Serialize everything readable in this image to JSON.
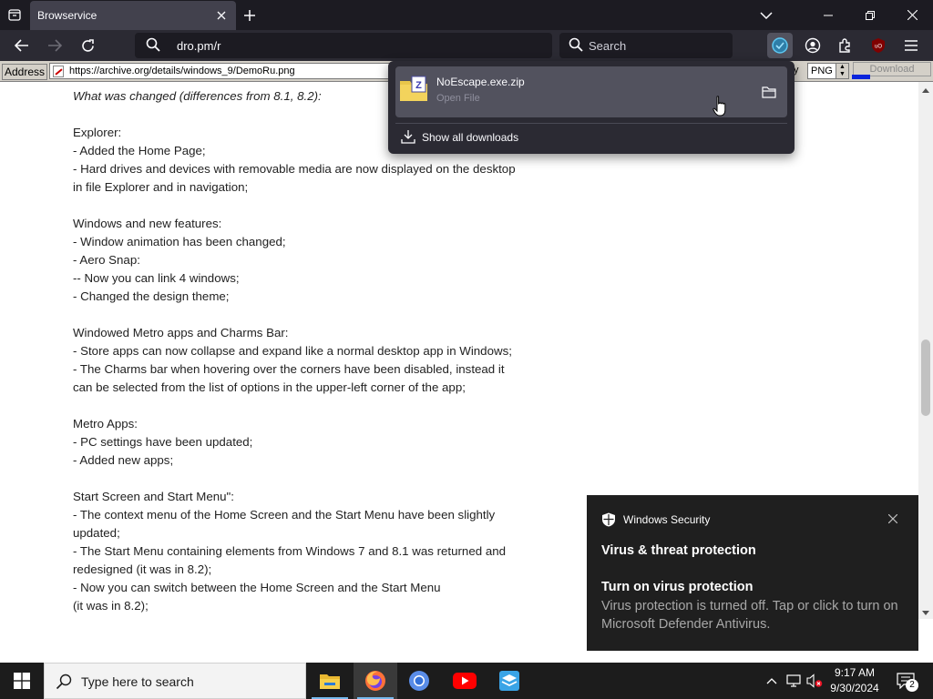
{
  "browser": {
    "tab_title": "Browservice",
    "url": "dro.pm/r",
    "search_placeholder": "Search"
  },
  "legacy_toolbar": {
    "address_label": "Address",
    "address_value": "https://archive.org/details/windows_9/DemoRu.png",
    "quality_label": "ty",
    "format_value": "PNG",
    "download_label": "Download"
  },
  "article": {
    "lines": [
      "What was changed (differences from 8.1, 8.2):",
      "",
      "Explorer:",
      "- Added the Home Page;",
      "- Hard drives and devices with removable media are now displayed on the desktop",
      "in file Explorer and in navigation;",
      "",
      "Windows and new features:",
      "- Window animation has been changed;",
      "- Aero Snap:",
      "-- Now you can link 4 windows;",
      "- Changed the design theme;",
      "",
      "Windowed Metro apps and Charms Bar:",
      "- Store apps can now collapse and expand like a normal desktop app in Windows;",
      "- The Charms bar when hovering over the corners have been disabled, instead it",
      "can be selected from the list of options in the upper-left corner of the app;",
      "",
      "Metro Apps:",
      "- PC settings have been updated;",
      "- Added new apps;",
      "",
      "Start Screen and Start Menu\":",
      "- The context menu of the Home Screen and the Start Menu have been slightly",
      "updated;",
      "- The Start Menu containing elements from Windows 7 and 8.1 was returned and",
      "redesigned (it was in 8.2);",
      "- Now you can switch between the Home Screen and the Start Menu",
      "(it was in 8.2);"
    ]
  },
  "downloads_panel": {
    "file_name": "NoEscape.exe.zip",
    "file_status": "Open File",
    "show_all_label": "Show all downloads"
  },
  "toast": {
    "app_name": "Windows Security",
    "headline": "Virus & threat protection",
    "title": "Turn on virus protection",
    "body": "Virus protection is turned off. Tap or click to turn on Microsoft Defender Antivirus."
  },
  "taskbar": {
    "search_placeholder": "Type here to search",
    "time": "9:17 AM",
    "date": "9/30/2024",
    "notification_count": "2"
  },
  "colors": {
    "browser_chrome": "#2b2a33",
    "tab_strip": "#1c1b22",
    "toast_bg": "#1f1f1f",
    "taskbar_bg": "#1c1c1c",
    "download_accent": "#0a24dc"
  },
  "icons": [
    "tab-list-icon",
    "close-icon",
    "plus-icon",
    "chevron-down-icon",
    "minimize-icon",
    "restore-icon",
    "back-arrow-icon",
    "forward-arrow-icon",
    "reload-icon",
    "search-icon",
    "download-progress-icon",
    "account-icon",
    "extensions-icon",
    "ublock-icon",
    "hamburger-menu-icon",
    "zip-file-icon",
    "folder-icon",
    "download-icon",
    "shield-icon",
    "windows-logo-icon",
    "file-explorer-icon",
    "firefox-icon",
    "chromium-icon",
    "youtube-icon",
    "app-icon",
    "chevron-up-icon",
    "network-icon",
    "volume-muted-icon",
    "notification-icon"
  ]
}
